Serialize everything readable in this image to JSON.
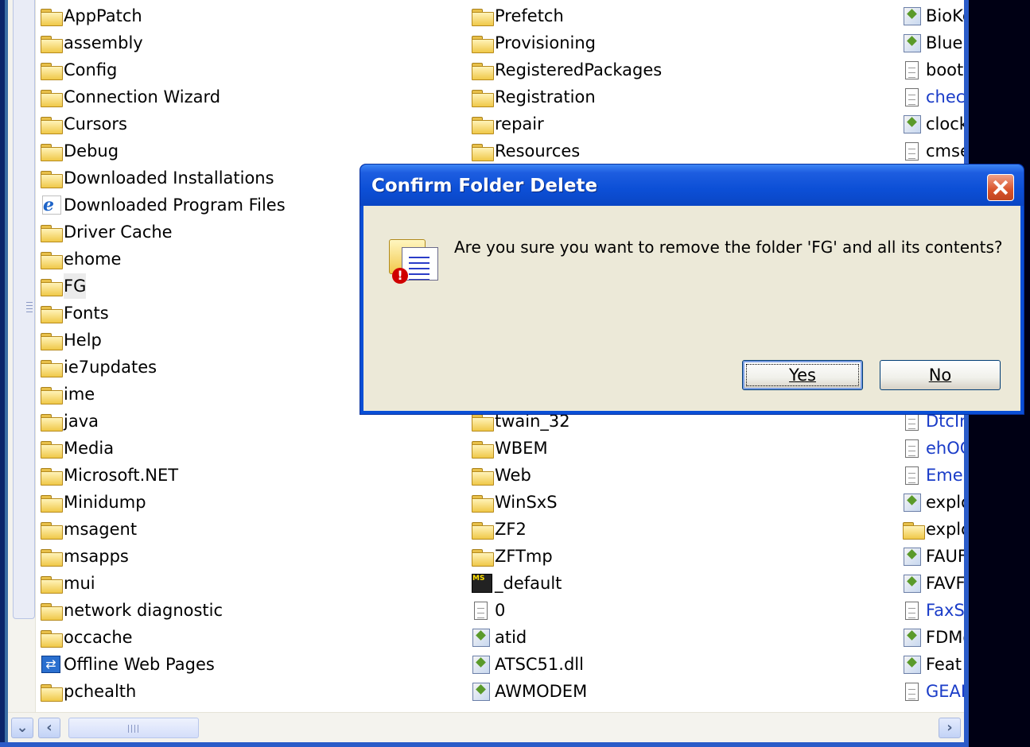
{
  "explorer": {
    "column1": [
      {
        "name": "AppPatch",
        "icon": "folder-icon"
      },
      {
        "name": "assembly",
        "icon": "folder-icon"
      },
      {
        "name": "Config",
        "icon": "folder-icon"
      },
      {
        "name": "Connection Wizard",
        "icon": "folder-icon"
      },
      {
        "name": "Cursors",
        "icon": "folder-icon"
      },
      {
        "name": "Debug",
        "icon": "folder-icon"
      },
      {
        "name": "Downloaded Installations",
        "icon": "folder-icon"
      },
      {
        "name": "Downloaded Program Files",
        "icon": "ie-folder-icon"
      },
      {
        "name": "Driver Cache",
        "icon": "folder-icon"
      },
      {
        "name": "ehome",
        "icon": "folder-icon"
      },
      {
        "name": "FG",
        "icon": "folder-icon",
        "selected": true
      },
      {
        "name": "Fonts",
        "icon": "folder-icon"
      },
      {
        "name": "Help",
        "icon": "folder-icon"
      },
      {
        "name": "ie7updates",
        "icon": "folder-icon"
      },
      {
        "name": "ime",
        "icon": "folder-icon"
      },
      {
        "name": "java",
        "icon": "folder-icon"
      },
      {
        "name": "Media",
        "icon": "folder-icon"
      },
      {
        "name": "Microsoft.NET",
        "icon": "folder-icon"
      },
      {
        "name": "Minidump",
        "icon": "folder-icon"
      },
      {
        "name": "msagent",
        "icon": "folder-icon"
      },
      {
        "name": "msapps",
        "icon": "folder-icon"
      },
      {
        "name": "mui",
        "icon": "folder-icon"
      },
      {
        "name": "network diagnostic",
        "icon": "folder-icon"
      },
      {
        "name": "occache",
        "icon": "folder-icon"
      },
      {
        "name": "Offline Web Pages",
        "icon": "sync-folder-icon"
      },
      {
        "name": "pchealth",
        "icon": "folder-icon"
      }
    ],
    "column2_top": [
      {
        "name": "Prefetch",
        "icon": "folder-icon"
      },
      {
        "name": "Provisioning",
        "icon": "folder-icon"
      },
      {
        "name": "RegisteredPackages",
        "icon": "folder-icon"
      },
      {
        "name": "Registration",
        "icon": "folder-icon"
      },
      {
        "name": "repair",
        "icon": "folder-icon"
      },
      {
        "name": "Resources",
        "icon": "folder-icon"
      }
    ],
    "column2_bottom": [
      {
        "name": "twain_32",
        "icon": "folder-icon"
      },
      {
        "name": "WBEM",
        "icon": "folder-icon"
      },
      {
        "name": "Web",
        "icon": "folder-icon"
      },
      {
        "name": "WinSxS",
        "icon": "folder-icon"
      },
      {
        "name": "ZF2",
        "icon": "folder-icon"
      },
      {
        "name": "ZFTmp",
        "icon": "folder-icon"
      },
      {
        "name": "_default",
        "icon": "media-file-icon"
      },
      {
        "name": "0",
        "icon": "text-file-icon"
      },
      {
        "name": "atid",
        "icon": "settings-file-icon"
      },
      {
        "name": "ATSC51.dll",
        "icon": "dll-file-icon"
      },
      {
        "name": "AWMODEM",
        "icon": "settings-file-icon"
      }
    ],
    "column3_top": [
      {
        "name": "BioKe",
        "icon": "exe-file-icon",
        "blue": false
      },
      {
        "name": "Blue",
        "icon": "wand-file-icon",
        "blue": false
      },
      {
        "name": "boot",
        "icon": "ini-file-icon",
        "blue": false
      },
      {
        "name": "chec",
        "icon": "ini-file-icon",
        "blue": true
      },
      {
        "name": "clock",
        "icon": "clock-file-icon",
        "blue": false
      },
      {
        "name": "cmse",
        "icon": "text-file-icon",
        "blue": false
      }
    ],
    "column3_bottom": [
      {
        "name": "DtcIr",
        "icon": "text-file-icon",
        "blue": true
      },
      {
        "name": "ehOC",
        "icon": "text-file-icon",
        "blue": true
      },
      {
        "name": "Emer",
        "icon": "text-file-icon",
        "blue": true
      },
      {
        "name": "explo",
        "icon": "explorer-exe-icon",
        "blue": false
      },
      {
        "name": "explo",
        "icon": "explorer-file-icon",
        "blue": false
      },
      {
        "name": "FAUF",
        "icon": "exe-file-icon",
        "blue": false
      },
      {
        "name": "FAVF",
        "icon": "exe-file-icon",
        "blue": false
      },
      {
        "name": "FaxS",
        "icon": "text-file-icon",
        "blue": true
      },
      {
        "name": "FDMo",
        "icon": "settings-file-icon",
        "blue": false
      },
      {
        "name": "Feat",
        "icon": "wand-file-icon",
        "blue": false
      },
      {
        "name": "GEAF",
        "icon": "text-file-icon",
        "blue": true
      }
    ]
  },
  "dialog": {
    "title": "Confirm Folder Delete",
    "message": "Are you sure you want to remove the folder 'FG' and all its contents?",
    "yes_label": "Yes",
    "no_label": "No",
    "icon": "folder-delete-warning-icon"
  },
  "colors": {
    "title_bar": "#0a4fd6",
    "dialog_face": "#ece9d8",
    "close_button": "#d8532a",
    "link_blue": "#1a3cc8"
  }
}
